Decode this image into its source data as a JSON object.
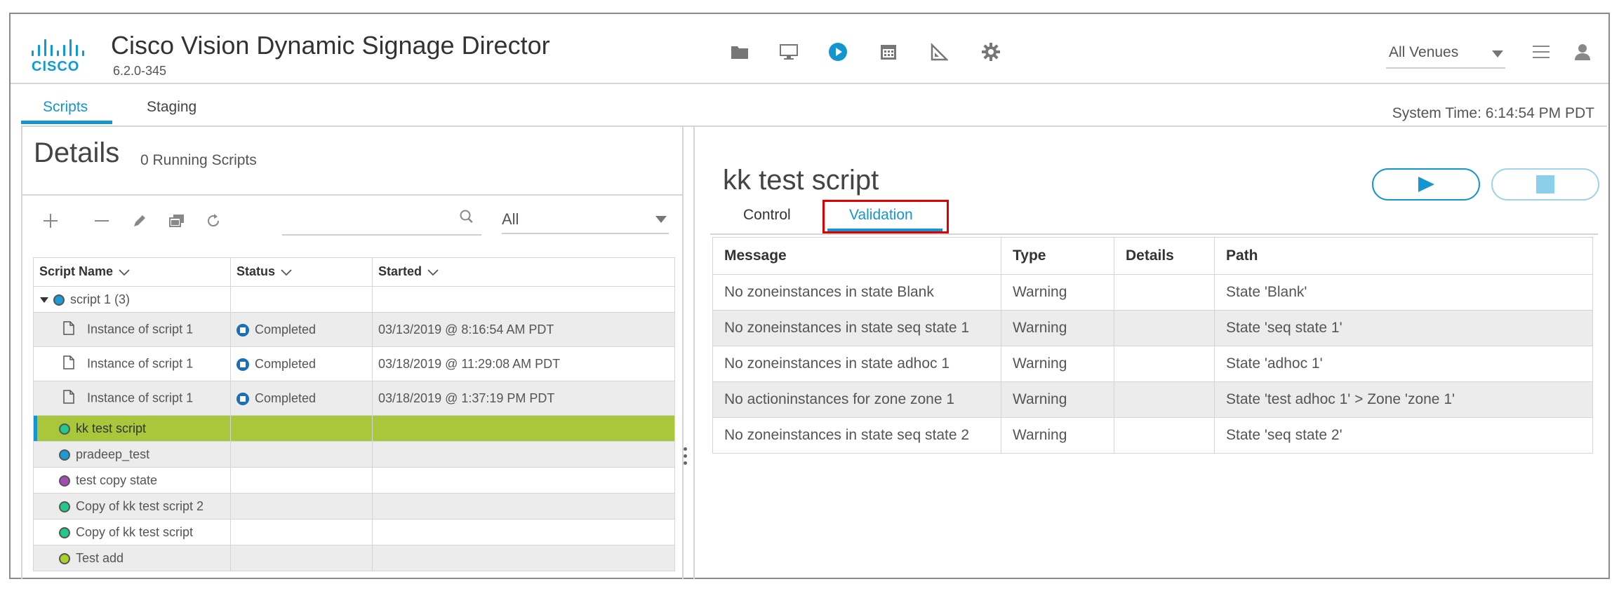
{
  "header": {
    "logo_text": "CISCO",
    "title": "Cisco Vision Dynamic Signage Director",
    "version": "6.2.0-345",
    "nav_icons": [
      "folder-icon",
      "monitor-icon",
      "play-circle-icon",
      "calendar-icon",
      "triangle-ruler-icon",
      "gear-icon"
    ],
    "venue": "All Venues",
    "accent_color": "#1396cf"
  },
  "tabs": [
    {
      "label": "Scripts",
      "active": true
    },
    {
      "label": "Staging",
      "active": false
    }
  ],
  "system_time": "System Time: 6:14:54 PM PDT",
  "details": {
    "title": "Details",
    "running": "0 Running Scripts",
    "search_placeholder": "",
    "filter": "All"
  },
  "script_table": {
    "columns": [
      "Script Name",
      "Status",
      "Started"
    ],
    "rows": [
      {
        "name": "script 1 (3)",
        "status": "",
        "started": "",
        "dot_color": "#1b9ad6"
      },
      {
        "name": "Instance of script 1",
        "status": "Completed",
        "started": "03/13/2019 @ 8:16:54 AM PDT"
      },
      {
        "name": "Instance of script 1",
        "status": "Completed",
        "started": "03/18/2019 @ 11:29:08 AM PDT"
      },
      {
        "name": "Instance of script 1",
        "status": "Completed",
        "started": "03/18/2019 @ 1:37:19 PM PDT"
      },
      {
        "name": "kk test script",
        "status": "",
        "started": "",
        "dot_color": "#22c98a"
      },
      {
        "name": "pradeep_test",
        "status": "",
        "started": "",
        "dot_color": "#1b9ad6"
      },
      {
        "name": "test copy state",
        "status": "",
        "started": "",
        "dot_color": "#a54bb5"
      },
      {
        "name": "Copy of kk test script 2",
        "status": "",
        "started": "",
        "dot_color": "#22c98a"
      },
      {
        "name": "Copy of kk test script",
        "status": "",
        "started": "",
        "dot_color": "#22c98a"
      },
      {
        "name": "Test add",
        "status": "",
        "started": "",
        "dot_color": "#a8d12a"
      }
    ]
  },
  "right_panel": {
    "title": "kk test script",
    "tabs": [
      {
        "label": "Control",
        "active": false
      },
      {
        "label": "Validation",
        "active": true
      }
    ],
    "validation": {
      "columns": [
        "Message",
        "Type",
        "Details",
        "Path"
      ],
      "rows": [
        {
          "message": "No zoneinstances in state Blank",
          "type": "Warning",
          "details": "",
          "path": "State 'Blank'"
        },
        {
          "message": "No zoneinstances in state seq state 1",
          "type": "Warning",
          "details": "",
          "path": "State 'seq state 1'"
        },
        {
          "message": "No zoneinstances in state adhoc 1",
          "type": "Warning",
          "details": "",
          "path": "State 'adhoc 1'"
        },
        {
          "message": "No actioninstances for zone zone 1",
          "type": "Warning",
          "details": "",
          "path": "State 'test adhoc 1' > Zone 'zone 1'"
        },
        {
          "message": "No zoneinstances in state seq state 2",
          "type": "Warning",
          "details": "",
          "path": "State 'seq state 2'"
        }
      ]
    }
  }
}
